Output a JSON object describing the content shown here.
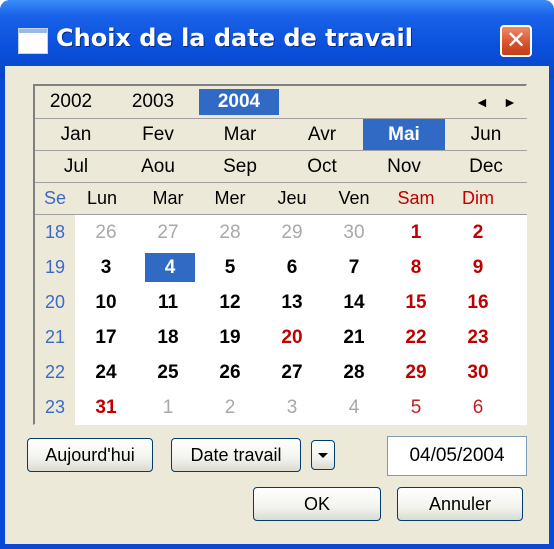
{
  "window": {
    "title": "Choix de la date de travail"
  },
  "icons": {
    "app": "window-icon",
    "close": "close-icon",
    "prev": "chevron-left-icon",
    "next": "chevron-right-icon",
    "dropdown": "chevron-down-icon"
  },
  "colors": {
    "selection": "#316ac5",
    "weekend": "#c00000",
    "week_number": "#3a6ac8",
    "titlebar": "#0a50dc"
  },
  "years": [
    {
      "label": "2002",
      "selected": false
    },
    {
      "label": "2003",
      "selected": false
    },
    {
      "label": "2004",
      "selected": true
    }
  ],
  "nav": {
    "prev": "◄",
    "next": "►"
  },
  "months": [
    [
      "Jan",
      "Fev",
      "Mar",
      "Avr",
      "Mai",
      "Jun"
    ],
    [
      "Jul",
      "Aou",
      "Sep",
      "Oct",
      "Nov",
      "Dec"
    ]
  ],
  "selected_month": "Mai",
  "week_header": "Se",
  "weekdays": [
    "Lun",
    "Mar",
    "Mer",
    "Jeu",
    "Ven",
    "Sam",
    "Dim"
  ],
  "weeks": [
    {
      "num": "18",
      "days": [
        {
          "d": "26",
          "t": "other"
        },
        {
          "d": "27",
          "t": "other"
        },
        {
          "d": "28",
          "t": "other"
        },
        {
          "d": "29",
          "t": "other"
        },
        {
          "d": "30",
          "t": "other"
        },
        {
          "d": "1",
          "t": "wkend"
        },
        {
          "d": "2",
          "t": "wkend"
        }
      ]
    },
    {
      "num": "19",
      "days": [
        {
          "d": "3",
          "t": "cur"
        },
        {
          "d": "4",
          "t": "sel"
        },
        {
          "d": "5",
          "t": "cur"
        },
        {
          "d": "6",
          "t": "cur"
        },
        {
          "d": "7",
          "t": "cur"
        },
        {
          "d": "8",
          "t": "wkend"
        },
        {
          "d": "9",
          "t": "wkend"
        }
      ]
    },
    {
      "num": "20",
      "days": [
        {
          "d": "10",
          "t": "cur"
        },
        {
          "d": "11",
          "t": "cur"
        },
        {
          "d": "12",
          "t": "cur"
        },
        {
          "d": "13",
          "t": "cur"
        },
        {
          "d": "14",
          "t": "cur"
        },
        {
          "d": "15",
          "t": "wkend"
        },
        {
          "d": "16",
          "t": "wkend"
        }
      ]
    },
    {
      "num": "21",
      "days": [
        {
          "d": "17",
          "t": "cur"
        },
        {
          "d": "18",
          "t": "cur"
        },
        {
          "d": "19",
          "t": "cur"
        },
        {
          "d": "20",
          "t": "hol"
        },
        {
          "d": "21",
          "t": "cur"
        },
        {
          "d": "22",
          "t": "wkend"
        },
        {
          "d": "23",
          "t": "wkend"
        }
      ]
    },
    {
      "num": "22",
      "days": [
        {
          "d": "24",
          "t": "cur"
        },
        {
          "d": "25",
          "t": "cur"
        },
        {
          "d": "26",
          "t": "cur"
        },
        {
          "d": "27",
          "t": "cur"
        },
        {
          "d": "28",
          "t": "cur"
        },
        {
          "d": "29",
          "t": "wkend"
        },
        {
          "d": "30",
          "t": "wkend"
        }
      ]
    },
    {
      "num": "23",
      "days": [
        {
          "d": "31",
          "t": "hol"
        },
        {
          "d": "1",
          "t": "other"
        },
        {
          "d": "2",
          "t": "other"
        },
        {
          "d": "3",
          "t": "other"
        },
        {
          "d": "4",
          "t": "other"
        },
        {
          "d": "5",
          "t": "wkend-other"
        },
        {
          "d": "6",
          "t": "wkend-other"
        }
      ]
    }
  ],
  "buttons": {
    "today": "Aujourd'hui",
    "work_date": "Date travail",
    "ok": "OK",
    "cancel": "Annuler"
  },
  "date_field": {
    "value": "04/05/2004"
  }
}
